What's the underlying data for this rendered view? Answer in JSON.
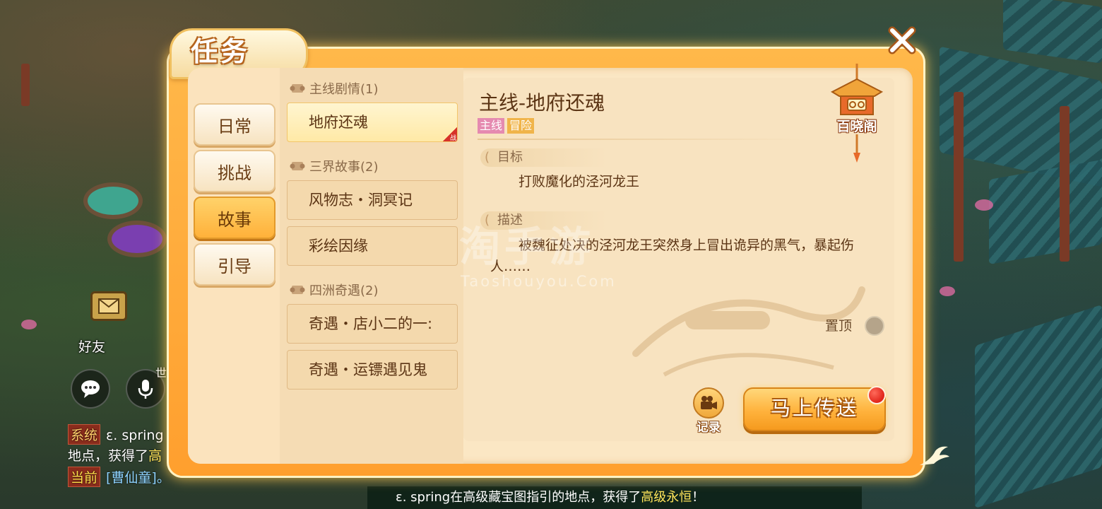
{
  "panel": {
    "title": "任务",
    "close_icon": "close-icon"
  },
  "categories": [
    {
      "label": "日常",
      "active": false
    },
    {
      "label": "挑战",
      "active": false
    },
    {
      "label": "故事",
      "active": true
    },
    {
      "label": "引导",
      "active": false
    }
  ],
  "quest_groups": [
    {
      "header": "主线剧情(1)",
      "items": [
        {
          "label": "地府还魂",
          "active": true,
          "badge": "战"
        }
      ]
    },
    {
      "header": "三界故事(2)",
      "items": [
        {
          "label": "风物志・洞冥记",
          "active": false
        },
        {
          "label": "彩绘因缘",
          "active": false
        }
      ]
    },
    {
      "header": "四洲奇遇(2)",
      "items": [
        {
          "label": "奇遇・店小二的一:",
          "active": false
        },
        {
          "label": "奇遇・运镖遇见鬼",
          "active": false
        }
      ]
    }
  ],
  "detail": {
    "title": "主线-地府还魂",
    "tags": [
      "主线",
      "冒险"
    ],
    "goal_label": "目标",
    "goal_text": "打败魔化的泾河龙王",
    "desc_label": "描述",
    "desc_line1": "被魏征处决的泾河龙王突然身上冒出诡异的黑气，暴起伤",
    "desc_line2": "人……",
    "baixiao_label": "百晓阁",
    "pin_label": "置顶",
    "record_label": "记录",
    "teleport_label": "马上传送"
  },
  "watermark": {
    "main": "淘手游",
    "sub": "Taoshouyou.Com"
  },
  "hud": {
    "friend_label": "好友",
    "world_label": "世",
    "chat": [
      {
        "tag": "系统",
        "text": "ε. spring"
      },
      {
        "text_a": "地点，获得了",
        "text_b": "高"
      },
      {
        "tag": "当前",
        "text": "[曹仙童]。"
      }
    ],
    "bottom_text_a": "ε. spring在高级藏宝图指引的地点，获得了",
    "bottom_text_b": "高级永恒",
    "bottom_text_c": "！"
  },
  "colors": {
    "panel_orange": "#ff9f2e",
    "active_tab": "#ffb13a",
    "tag_main": "#e58ab0",
    "tag_adventure": "#f0b44a",
    "notification_red": "#e0241a"
  }
}
